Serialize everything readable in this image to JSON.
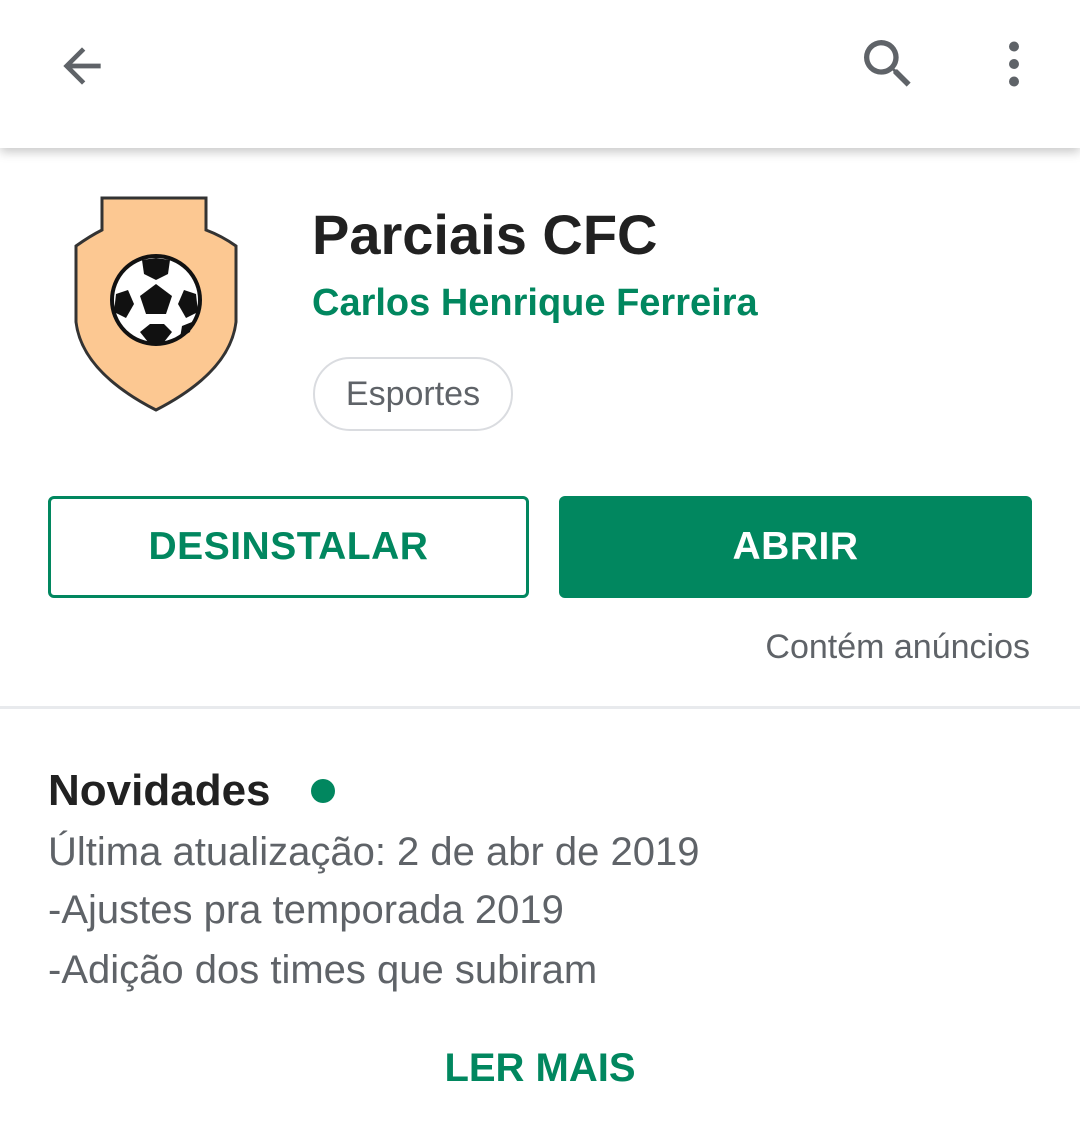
{
  "toolbar": {
    "back_icon": "arrow-back-icon",
    "search_icon": "search-icon",
    "more_icon": "more-vert-icon"
  },
  "app": {
    "title": "Parciais CFC",
    "developer": "Carlos Henrique Ferreira",
    "category": "Esportes",
    "icon": "shield-soccer-ball-icon"
  },
  "actions": {
    "uninstall_label": "DESINSTALAR",
    "open_label": "ABRIR",
    "ads_note": "Contém anúncios"
  },
  "whats_new": {
    "title": "Novidades",
    "lines": [
      "Última atualização: 2 de abr de 2019",
      "-Ajustes pra temporada 2019",
      "-Adição dos times que subiram"
    ],
    "read_more_label": "LER MAIS"
  },
  "colors": {
    "accent": "#01875f",
    "text_primary": "#212121",
    "text_secondary": "#5f6368",
    "icon_shield": "#fcc892"
  }
}
